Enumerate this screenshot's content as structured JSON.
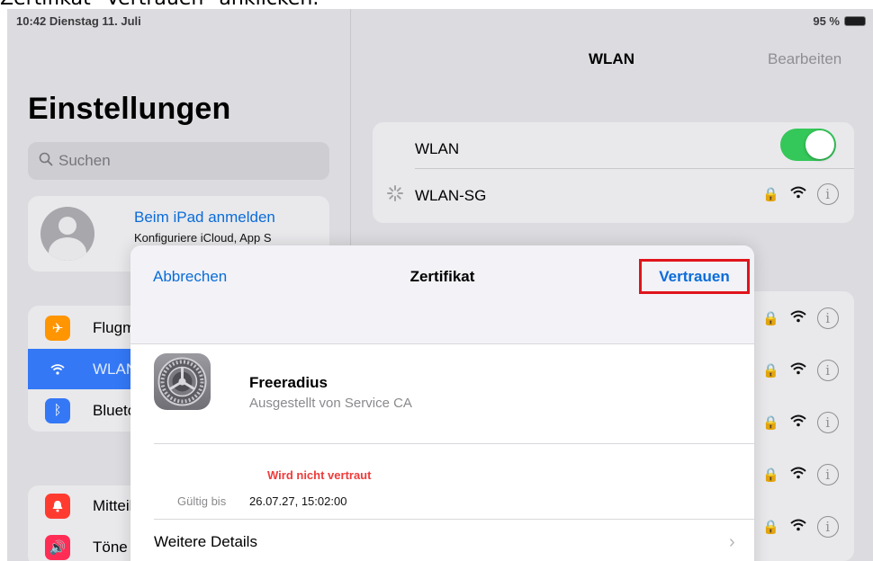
{
  "caption": "Zertifikat \"Vertrauen\" anklicken.",
  "status": {
    "time_date": "10:42  Dienstag 11. Juli",
    "battery": "95 %"
  },
  "sidebar": {
    "title": "Einstellungen",
    "search_placeholder": "Suchen",
    "account": {
      "link": "Beim iPad anmelden",
      "subtitle": "Konfiguriere iCloud, App S"
    },
    "items": [
      {
        "label": "Flugmodus",
        "icon": "airplane-icon",
        "color": "#ff9500"
      },
      {
        "label": "WLAN",
        "icon": "wifi-icon",
        "color": "#3478f6"
      },
      {
        "label": "Bluetooth",
        "icon": "bluetooth-icon",
        "color": "#3478f6"
      },
      {
        "label": "Mitteilungen",
        "icon": "notifications-icon",
        "color": "#ff3b30"
      },
      {
        "label": "Töne",
        "icon": "sound-icon",
        "color": "#ff2d55"
      }
    ]
  },
  "pane": {
    "title": "WLAN",
    "edit": "Bearbeiten",
    "wifi_label": "WLAN",
    "wifi_on": true,
    "connecting_network": "WLAN-SG"
  },
  "modal": {
    "cancel": "Abbrechen",
    "title": "Zertifikat",
    "trust": "Vertrauen",
    "cert_name": "Freeradius",
    "cert_issuer": "Ausgestellt von Service CA",
    "status": "Wird nicht vertraut",
    "valid_key": "Gültig bis",
    "valid_value": "26.07.27, 15:02:00",
    "more": "Weitere Details"
  },
  "colors": {
    "accent": "#0a6cd8",
    "highlight_box": "#e0141b",
    "warning": "#ef3b3b",
    "toggle_on": "#34c759"
  }
}
